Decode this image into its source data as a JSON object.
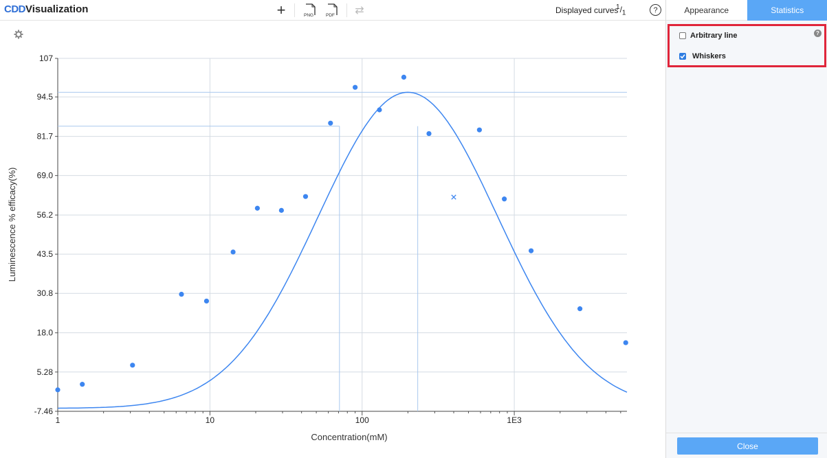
{
  "header": {
    "logo_brand": "CDD",
    "logo_title": "Visualization",
    "add_symbol": "+",
    "png_label": "PNG",
    "pdf_label": "PDF",
    "swap_symbol": "⇄",
    "displayed_curves_label": "Displayed curves",
    "displayed_curves_num": "1",
    "displayed_curves_den": "1",
    "help_symbol": "?"
  },
  "sidebar": {
    "tabs": [
      {
        "label": "Appearance",
        "active": false
      },
      {
        "label": "Statistics",
        "active": true
      }
    ],
    "options": [
      {
        "label": "Arbitrary line",
        "checked": false
      },
      {
        "label": "Whiskers",
        "checked": true
      }
    ],
    "help_symbol": "?",
    "close_label": "Close",
    "accent_color": "#5aa7f6",
    "highlight_color": "#e0253a"
  },
  "chart_data": {
    "type": "scatter",
    "xlabel": "Concentration(mM)",
    "ylabel": "Luminescence % efficacy(%)",
    "x_scale": "log",
    "xlim": [
      1,
      5500
    ],
    "ylim": [
      -7.46,
      107
    ],
    "x_ticks": [
      {
        "value": 1,
        "label": "1"
      },
      {
        "value": 10,
        "label": "10"
      },
      {
        "value": 100,
        "label": "100"
      },
      {
        "value": 1000,
        "label": "1E3"
      }
    ],
    "y_ticks": [
      {
        "value": 107,
        "label": "107"
      },
      {
        "value": 94.5,
        "label": "94.5"
      },
      {
        "value": 81.7,
        "label": "81.7"
      },
      {
        "value": 69.0,
        "label": "69.0"
      },
      {
        "value": 56.2,
        "label": "56.2"
      },
      {
        "value": 43.5,
        "label": "43.5"
      },
      {
        "value": 30.8,
        "label": "30.8"
      },
      {
        "value": 18.0,
        "label": "18.0"
      },
      {
        "value": 5.28,
        "label": "5.28"
      },
      {
        "value": -7.46,
        "label": "-7.46"
      }
    ],
    "grid": true,
    "points": [
      {
        "x": 1.0,
        "y": -0.5
      },
      {
        "x": 1.45,
        "y": 1.3
      },
      {
        "x": 3.1,
        "y": 7.5
      },
      {
        "x": 6.5,
        "y": 30.5
      },
      {
        "x": 9.5,
        "y": 28.3
      },
      {
        "x": 14.2,
        "y": 44.2
      },
      {
        "x": 20.5,
        "y": 58.4
      },
      {
        "x": 29.5,
        "y": 57.7
      },
      {
        "x": 42.5,
        "y": 62.2
      },
      {
        "x": 62.0,
        "y": 86.0
      },
      {
        "x": 90.0,
        "y": 97.6
      },
      {
        "x": 130.0,
        "y": 90.3
      },
      {
        "x": 188.0,
        "y": 100.9
      },
      {
        "x": 275.0,
        "y": 82.6
      },
      {
        "x": 590.0,
        "y": 83.8
      },
      {
        "x": 860.0,
        "y": 61.4
      },
      {
        "x": 1290.0,
        "y": 44.6
      },
      {
        "x": 2700.0,
        "y": 25.8
      },
      {
        "x": 5400.0,
        "y": 14.8
      }
    ],
    "excluded_points": [
      {
        "x": 400.0,
        "y": 62.0
      }
    ],
    "curve": {
      "model": "gaussian_log",
      "peak_x": 200,
      "peak_y": 96.0,
      "baseline": -6.5,
      "sigma_log": 0.59
    },
    "whiskers": {
      "h_lines_y": [
        96.0,
        85.0
      ],
      "v_lines_x": [
        71.0,
        232.0
      ]
    },
    "point_color": "#3d86f0",
    "curve_color": "#3d86f0"
  }
}
